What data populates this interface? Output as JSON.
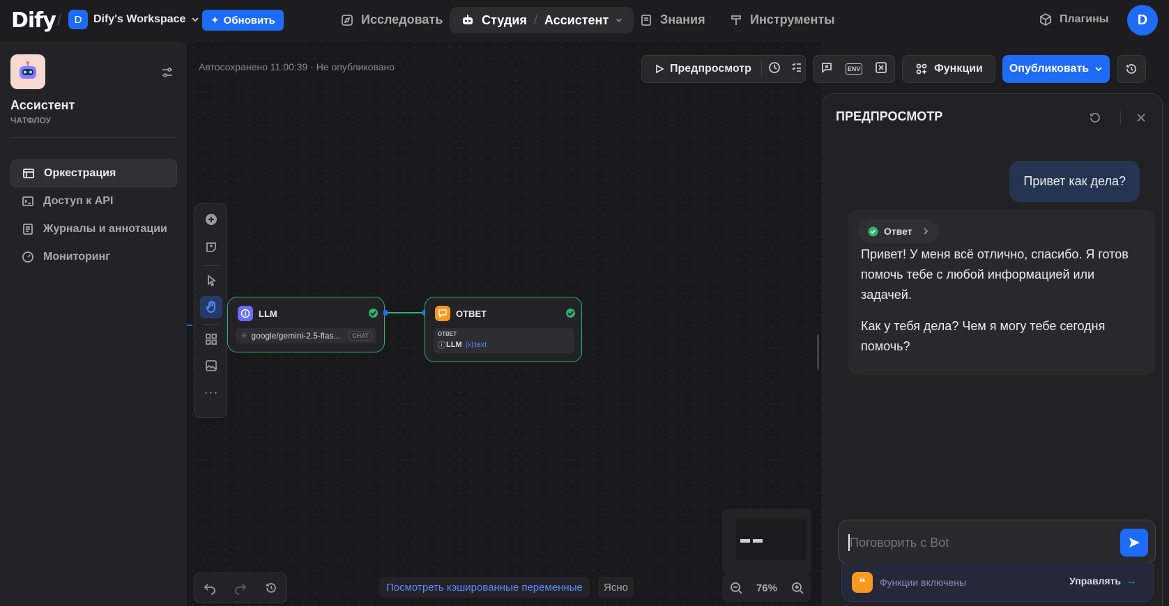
{
  "topbar": {
    "logo": "Dify",
    "workspace_initial": "D",
    "workspace_name": "Dify's Workspace",
    "upgrade_label": "Обновить",
    "nav_explore": "Исследовать",
    "nav_studio": "Студия",
    "nav_app": "Ассистент",
    "nav_knowledge": "Знания",
    "nav_tools": "Инструменты",
    "plugins": "Плагины",
    "user_initial": "D"
  },
  "sidebar": {
    "app_name": "Ассистент",
    "app_type": "ЧАТФЛОУ",
    "items": [
      {
        "label": "Оркестрация",
        "active": true
      },
      {
        "label": "Доступ к API"
      },
      {
        "label": "Журналы и аннотации"
      },
      {
        "label": "Мониторинг"
      }
    ]
  },
  "header": {
    "autosave_status": "Автосохранено 11:00:39 · Не опубликовано",
    "preview_button": "Предпросмотр",
    "features_button": "Функции",
    "publish_button": "Опубликовать",
    "env_label": "ENV"
  },
  "nodes": {
    "llm": {
      "title": "LLM",
      "model": "google/gemini-2.5-flas...",
      "badge": "CHAT"
    },
    "answer": {
      "title": "ОТВЕТ",
      "field_label": "ОТВЕТ",
      "var_source": "LLM",
      "var_prefix": "{x}",
      "var_name": "text"
    }
  },
  "canvas_footer": {
    "cached_vars": "Посмотреть кэшированные переменные",
    "clear": "Ясно",
    "zoom": "76%"
  },
  "preview": {
    "title": "ПРЕДПРОСМОТР",
    "user_message": "Привет как дела?",
    "bot_step": "Ответ",
    "bot_paragraph1": "Привет! У меня всё отлично, спасибо. Я готов помочь тебе с любой информацией или задачей.",
    "bot_paragraph2": "Как у тебя дела? Чем я могу тебе сегодня помочь?",
    "input_placeholder": "Поговорить с Bot",
    "features_enabled": "Функции включены",
    "manage": "Управлять"
  },
  "colors": {
    "accent": "#1e6bf5",
    "success": "#2fb36d",
    "llm": "#6b6ef9",
    "answer": "#f59a1e"
  }
}
